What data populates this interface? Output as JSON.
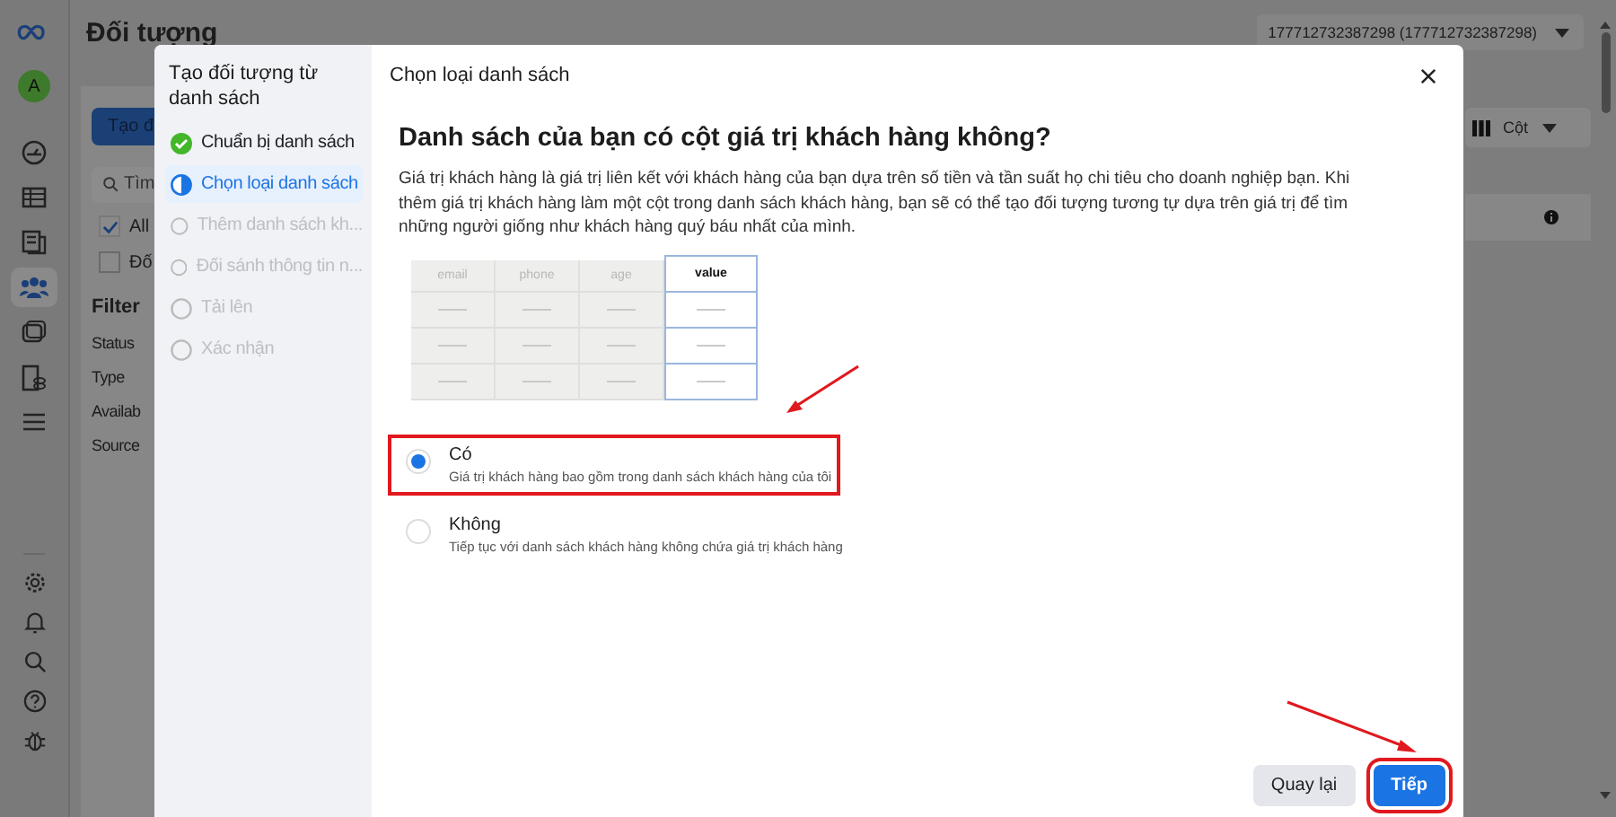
{
  "sidebar": {
    "avatar": "A",
    "items": [
      {
        "kind": "gauge",
        "selected": false
      },
      {
        "kind": "table",
        "selected": false
      },
      {
        "kind": "pages",
        "selected": false
      },
      {
        "kind": "people",
        "selected": true
      },
      {
        "kind": "catalog",
        "selected": false
      },
      {
        "kind": "stack",
        "selected": false
      },
      {
        "kind": "menu",
        "selected": false
      }
    ],
    "bottom_items": [
      {
        "kind": "settings"
      },
      {
        "kind": "bell"
      },
      {
        "kind": "search"
      },
      {
        "kind": "help"
      },
      {
        "kind": "bug"
      }
    ]
  },
  "page": {
    "title": "Đối tượng",
    "account_selector": "177712732387298 (177712732387298)"
  },
  "left_panel": {
    "create_button": "Tạo đ",
    "search": {
      "placeholder": "Tìm"
    },
    "checkboxes": [
      {
        "label": "All",
        "checked": true
      },
      {
        "label": "Đố",
        "checked": false
      }
    ],
    "filter": {
      "title": "Filter",
      "items": [
        "Status",
        "Type",
        "Availab",
        "Source"
      ]
    }
  },
  "toolbar": {
    "columns_button": "Cột"
  },
  "modal": {
    "sidebar_title": "Tạo đối tượng từ danh sách",
    "steps": [
      {
        "label": "Chuẩn bị danh sách",
        "completed": true,
        "selected": false
      },
      {
        "label": "Chọn loại danh sách",
        "completed": false,
        "selected": true
      },
      {
        "label": "Thêm danh sách kh...",
        "completed": false,
        "selected": false
      },
      {
        "label": "Đối sánh thông tin n...",
        "completed": false,
        "selected": false
      },
      {
        "label": "Tải lên",
        "completed": false,
        "selected": false
      },
      {
        "label": "Xác nhận",
        "completed": false,
        "selected": false
      }
    ],
    "title": "Chọn loại danh sách",
    "heading": "Danh sách của bạn có cột giá trị khách hàng không?",
    "description": "Giá trị khách hàng là giá trị liên kết với khách hàng của bạn dựa trên số tiền và tần suất họ chi tiêu cho doanh nghiệp bạn. Khi thêm giá trị khách hàng làm một cột trong danh sách khách hàng, bạn sẽ có thể tạo đối tượng tương tự dựa trên giá trị để tìm những người giống như khách hàng quý báu nhất của mình.",
    "preview_columns": [
      {
        "label": "email",
        "highlighted": false
      },
      {
        "label": "phone",
        "highlighted": false
      },
      {
        "label": "age",
        "highlighted": false
      },
      {
        "label": "value",
        "highlighted": true
      }
    ],
    "options": [
      {
        "label": "Có",
        "description": "Giá trị khách hàng bao gồm trong danh sách khách hàng của tôi",
        "selected": true,
        "highlighted": true
      },
      {
        "label": "Không",
        "description": "Tiếp tục với danh sách khách hàng không chứa giá trị khách hàng",
        "selected": false,
        "highlighted": false
      }
    ],
    "buttons": [
      {
        "label": "Quay lại",
        "kind": "secondary"
      },
      {
        "label": "Tiếp",
        "kind": "primary",
        "highlighted": true
      }
    ]
  }
}
